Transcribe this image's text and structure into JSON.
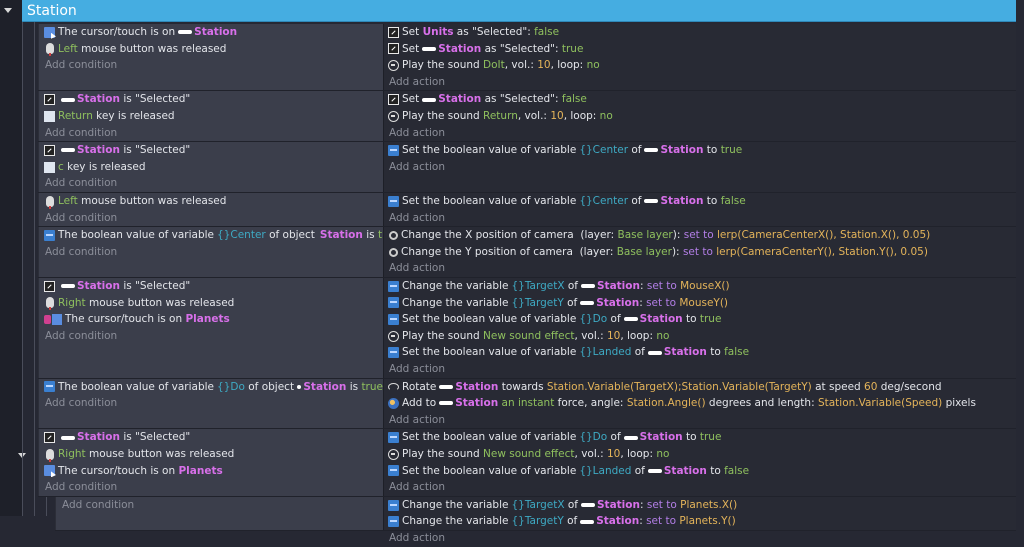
{
  "group": {
    "title": "Station"
  },
  "labels": {
    "add_condition": "Add condition",
    "add_action": "Add action"
  },
  "events": [
    {
      "lines": 4,
      "conditions": [
        {
          "icon": "cursor",
          "segs": [
            [
              "The cursor/touch is on",
              "plain"
            ],
            [
              "@Station",
              "obj"
            ]
          ]
        },
        {
          "icon": "mouse",
          "segs": [
            [
              "Left",
              "green"
            ],
            [
              " mouse button was released",
              "plain"
            ]
          ]
        }
      ],
      "actions": [
        {
          "icon": "select",
          "segs": [
            [
              "Set ",
              "plain"
            ],
            [
              "Units",
              "obj"
            ],
            [
              " as \"Selected\": ",
              "plain"
            ],
            [
              "false",
              "green"
            ]
          ]
        },
        {
          "icon": "select",
          "segs": [
            [
              "Set",
              "plain"
            ],
            [
              "@Station",
              "obj"
            ],
            [
              " as \"Selected\": ",
              "plain"
            ],
            [
              "true",
              "green"
            ]
          ]
        },
        {
          "icon": "sound",
          "segs": [
            [
              "Play the sound ",
              "plain"
            ],
            [
              "DoIt",
              "green"
            ],
            [
              ", vol.: ",
              "plain"
            ],
            [
              "10",
              "yellow"
            ],
            [
              ", loop: ",
              "plain"
            ],
            [
              "no",
              "green"
            ]
          ]
        }
      ]
    },
    {
      "lines": 3,
      "conditions": [
        {
          "icon": "select",
          "segs": [
            [
              "@Station",
              "obj"
            ],
            [
              " is \"Selected\"",
              "plain"
            ]
          ]
        },
        {
          "icon": "key",
          "segs": [
            [
              "Return",
              "green"
            ],
            [
              " key is released",
              "plain"
            ]
          ]
        }
      ],
      "actions": [
        {
          "icon": "select",
          "segs": [
            [
              "Set",
              "plain"
            ],
            [
              "@Station",
              "obj"
            ],
            [
              " as \"Selected\": ",
              "plain"
            ],
            [
              "false",
              "green"
            ]
          ]
        },
        {
          "icon": "sound",
          "segs": [
            [
              "Play the sound ",
              "plain"
            ],
            [
              "Return",
              "green"
            ],
            [
              ", vol.: ",
              "plain"
            ],
            [
              "10",
              "yellow"
            ],
            [
              ", loop: ",
              "plain"
            ],
            [
              "no",
              "green"
            ]
          ]
        }
      ]
    },
    {
      "lines": 3,
      "conditions": [
        {
          "icon": "select",
          "segs": [
            [
              "@Station",
              "obj"
            ],
            [
              " is \"Selected\"",
              "plain"
            ]
          ]
        },
        {
          "icon": "key",
          "segs": [
            [
              "c",
              "green"
            ],
            [
              " key is released",
              "plain"
            ]
          ]
        }
      ],
      "actions": [
        {
          "icon": "var",
          "segs": [
            [
              "Set the boolean value of variable",
              "plain"
            ],
            [
              "{}Center",
              "var"
            ],
            [
              " of",
              "plain"
            ],
            [
              "@Station",
              "obj"
            ],
            [
              " to ",
              "plain"
            ],
            [
              "true",
              "green"
            ]
          ]
        }
      ]
    },
    {
      "lines": 2,
      "conditions": [
        {
          "icon": "mouse",
          "segs": [
            [
              "Left",
              "green"
            ],
            [
              " mouse button was released",
              "plain"
            ]
          ]
        }
      ],
      "actions": [
        {
          "icon": "var",
          "segs": [
            [
              "Set the boolean value of variable",
              "plain"
            ],
            [
              "{}Center",
              "var"
            ],
            [
              " of",
              "plain"
            ],
            [
              "@Station",
              "obj"
            ],
            [
              " to ",
              "plain"
            ],
            [
              "false",
              "green"
            ]
          ]
        }
      ]
    },
    {
      "lines": 3,
      "conditions": [
        {
          "icon": "var",
          "segs": [
            [
              "The boolean value of variable",
              "plain"
            ],
            [
              "{}Center",
              "var"
            ],
            [
              " of object",
              "plain"
            ],
            [
              "@Station",
              "obj"
            ],
            [
              " is ",
              "plain"
            ],
            [
              "true",
              "green"
            ]
          ]
        }
      ],
      "actions": [
        {
          "icon": "camera",
          "segs": [
            [
              "Change the X position of camera  (layer: ",
              "plain"
            ],
            [
              "Base layer",
              "green"
            ],
            [
              "): ",
              "plain"
            ],
            [
              "set to ",
              "purple"
            ],
            [
              "lerp(CameraCenterX(), Station.X(), 0.05)",
              "yellow"
            ]
          ]
        },
        {
          "icon": "camera",
          "segs": [
            [
              "Change the Y position of camera  (layer: ",
              "plain"
            ],
            [
              "Base layer",
              "green"
            ],
            [
              "): ",
              "plain"
            ],
            [
              "set to ",
              "purple"
            ],
            [
              "lerp(CameraCenterY(), Station.Y(), 0.05)",
              "yellow"
            ]
          ]
        }
      ]
    },
    {
      "lines": 6,
      "conditions": [
        {
          "icon": "select",
          "segs": [
            [
              "@Station",
              "obj"
            ],
            [
              " is \"Selected\"",
              "plain"
            ]
          ]
        },
        {
          "icon": "mouse",
          "segs": [
            [
              "Right",
              "green"
            ],
            [
              " mouse button was released",
              "plain"
            ]
          ]
        },
        {
          "icon": "multi",
          "segs": [
            [
              "The cursor/touch is on ",
              "plain"
            ],
            [
              "Planets",
              "obj"
            ]
          ]
        }
      ],
      "actions": [
        {
          "icon": "var",
          "segs": [
            [
              "Change the variable",
              "plain"
            ],
            [
              "{}TargetX",
              "var"
            ],
            [
              " of",
              "plain"
            ],
            [
              "@Station",
              "obj"
            ],
            [
              ": ",
              "plain"
            ],
            [
              "set to ",
              "purple"
            ],
            [
              "MouseX()",
              "yellow"
            ]
          ]
        },
        {
          "icon": "var",
          "segs": [
            [
              "Change the variable",
              "plain"
            ],
            [
              "{}TargetY",
              "var"
            ],
            [
              " of",
              "plain"
            ],
            [
              "@Station",
              "obj"
            ],
            [
              ": ",
              "plain"
            ],
            [
              "set to ",
              "purple"
            ],
            [
              "MouseY()",
              "yellow"
            ]
          ]
        },
        {
          "icon": "var",
          "segs": [
            [
              "Set the boolean value of variable",
              "plain"
            ],
            [
              "{}Do",
              "var"
            ],
            [
              " of",
              "plain"
            ],
            [
              "@Station",
              "obj"
            ],
            [
              " to ",
              "plain"
            ],
            [
              "true",
              "green"
            ]
          ]
        },
        {
          "icon": "sound",
          "segs": [
            [
              "Play the sound ",
              "plain"
            ],
            [
              "New sound effect",
              "green"
            ],
            [
              ", vol.: ",
              "plain"
            ],
            [
              "10",
              "yellow"
            ],
            [
              ", loop: ",
              "plain"
            ],
            [
              "no",
              "green"
            ]
          ]
        },
        {
          "icon": "var",
          "segs": [
            [
              "Set the boolean value of variable",
              "plain"
            ],
            [
              "{}Landed",
              "var"
            ],
            [
              " of",
              "plain"
            ],
            [
              "@Station",
              "obj"
            ],
            [
              " to ",
              "plain"
            ],
            [
              "false",
              "green"
            ]
          ]
        }
      ]
    },
    {
      "lines": 3,
      "conditions": [
        {
          "icon": "var",
          "segs": [
            [
              "The boolean value of variable",
              "plain"
            ],
            [
              "{}Do",
              "var"
            ],
            [
              " of object",
              "plain"
            ],
            [
              "@Station",
              "obj"
            ],
            [
              " is ",
              "plain"
            ],
            [
              "true",
              "green"
            ]
          ]
        }
      ],
      "actions": [
        {
          "icon": "rotate",
          "segs": [
            [
              "Rotate",
              "plain"
            ],
            [
              "@Station",
              "obj"
            ],
            [
              " towards ",
              "plain"
            ],
            [
              "Station.Variable(TargetX);Station.Variable(TargetY)",
              "yellow"
            ],
            [
              " at speed ",
              "plain"
            ],
            [
              "60",
              "yellow"
            ],
            [
              " deg/second",
              "plain"
            ]
          ]
        },
        {
          "icon": "force",
          "segs": [
            [
              "Add to",
              "plain"
            ],
            [
              "@Station",
              "obj"
            ],
            [
              " an instant",
              "green"
            ],
            [
              " force, angle: ",
              "plain"
            ],
            [
              "Station.Angle()",
              "yellow"
            ],
            [
              " degrees and length: ",
              "plain"
            ],
            [
              "Station.Variable(Speed)",
              "yellow"
            ],
            [
              " pixels",
              "plain"
            ]
          ]
        }
      ]
    },
    {
      "lines": 4,
      "conditions": [
        {
          "icon": "select",
          "segs": [
            [
              "@Station",
              "obj"
            ],
            [
              " is \"Selected\"",
              "plain"
            ]
          ]
        },
        {
          "icon": "mouse",
          "segs": [
            [
              "Right",
              "green"
            ],
            [
              " mouse button was released",
              "plain"
            ]
          ]
        },
        {
          "icon": "cursor",
          "segs": [
            [
              "The cursor/touch is on ",
              "plain"
            ],
            [
              "Planets",
              "obj"
            ]
          ]
        }
      ],
      "actions": [
        {
          "icon": "var",
          "segs": [
            [
              "Set the boolean value of variable",
              "plain"
            ],
            [
              "{}Do",
              "var"
            ],
            [
              " of",
              "plain"
            ],
            [
              "@Station",
              "obj"
            ],
            [
              " to ",
              "plain"
            ],
            [
              "true",
              "green"
            ]
          ]
        },
        {
          "icon": "sound",
          "segs": [
            [
              "Play the sound ",
              "plain"
            ],
            [
              "New sound effect",
              "green"
            ],
            [
              ", vol.: ",
              "plain"
            ],
            [
              "10",
              "yellow"
            ],
            [
              ", loop: ",
              "plain"
            ],
            [
              "no",
              "green"
            ]
          ]
        },
        {
          "icon": "var",
          "segs": [
            [
              "Set the boolean value of variable",
              "plain"
            ],
            [
              "{}Landed",
              "var"
            ],
            [
              " of",
              "plain"
            ],
            [
              "@Station",
              "obj"
            ],
            [
              " to ",
              "plain"
            ],
            [
              "false",
              "green"
            ]
          ]
        }
      ]
    },
    {
      "lines": 2,
      "sub": true,
      "conditions": [],
      "actions": [
        {
          "icon": "var",
          "segs": [
            [
              "Change the variable",
              "plain"
            ],
            [
              "{}TargetX",
              "var"
            ],
            [
              " of",
              "plain"
            ],
            [
              "@Station",
              "obj"
            ],
            [
              ": ",
              "plain"
            ],
            [
              "set to ",
              "purple"
            ],
            [
              "Planets.X()",
              "yellow"
            ]
          ]
        },
        {
          "icon": "var",
          "segs": [
            [
              "Change the variable",
              "plain"
            ],
            [
              "{}TargetY",
              "var"
            ],
            [
              " of",
              "plain"
            ],
            [
              "@Station",
              "obj"
            ],
            [
              ": ",
              "plain"
            ],
            [
              "set to ",
              "purple"
            ],
            [
              "Planets.Y()",
              "yellow"
            ]
          ]
        }
      ]
    }
  ]
}
